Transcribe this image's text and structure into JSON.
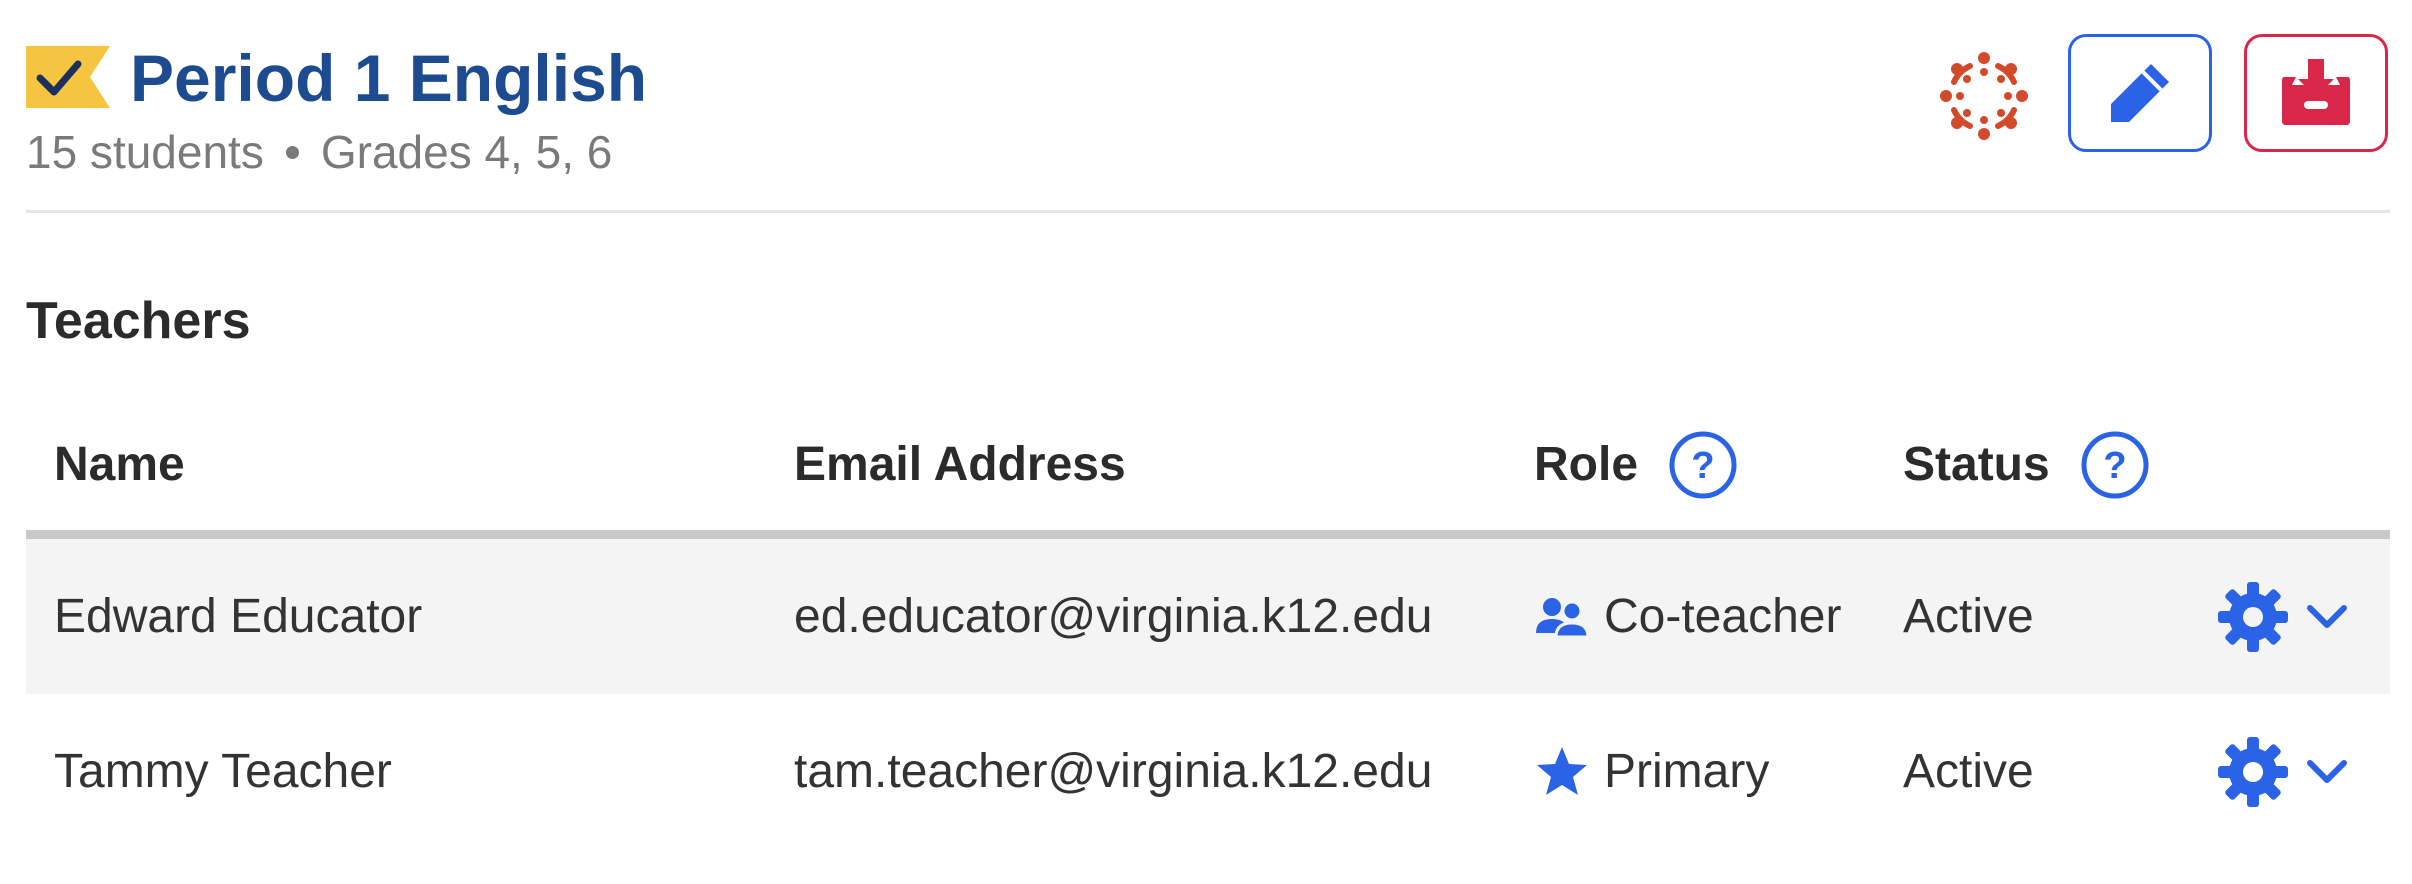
{
  "header": {
    "flag_icon": "checkmark-flag-icon",
    "title": "Period 1 English",
    "students": "15 students",
    "grades": "Grades 4, 5, 6",
    "canvas_icon": "canvas-lms-icon",
    "edit_icon": "pencil-icon",
    "archive_icon": "archive-box-icon"
  },
  "colors": {
    "title": "#1d4b8f",
    "accent_blue": "#2a63e6",
    "archive_red": "#d9274a",
    "flag_yellow": "#f5c542",
    "canvas_red": "#d24a2a"
  },
  "teachers": {
    "section_title": "Teachers",
    "columns": {
      "name": "Name",
      "email": "Email Address",
      "role": "Role",
      "status": "Status"
    },
    "rows": [
      {
        "name": "Edward Educator",
        "email": "ed.educator@virginia.k12.edu",
        "role": "Co-teacher",
        "role_icon": "people-icon",
        "status": "Active"
      },
      {
        "name": "Tammy Teacher",
        "email": "tam.teacher@virginia.k12.edu",
        "role": "Primary",
        "role_icon": "star-icon",
        "status": "Active"
      }
    ]
  }
}
